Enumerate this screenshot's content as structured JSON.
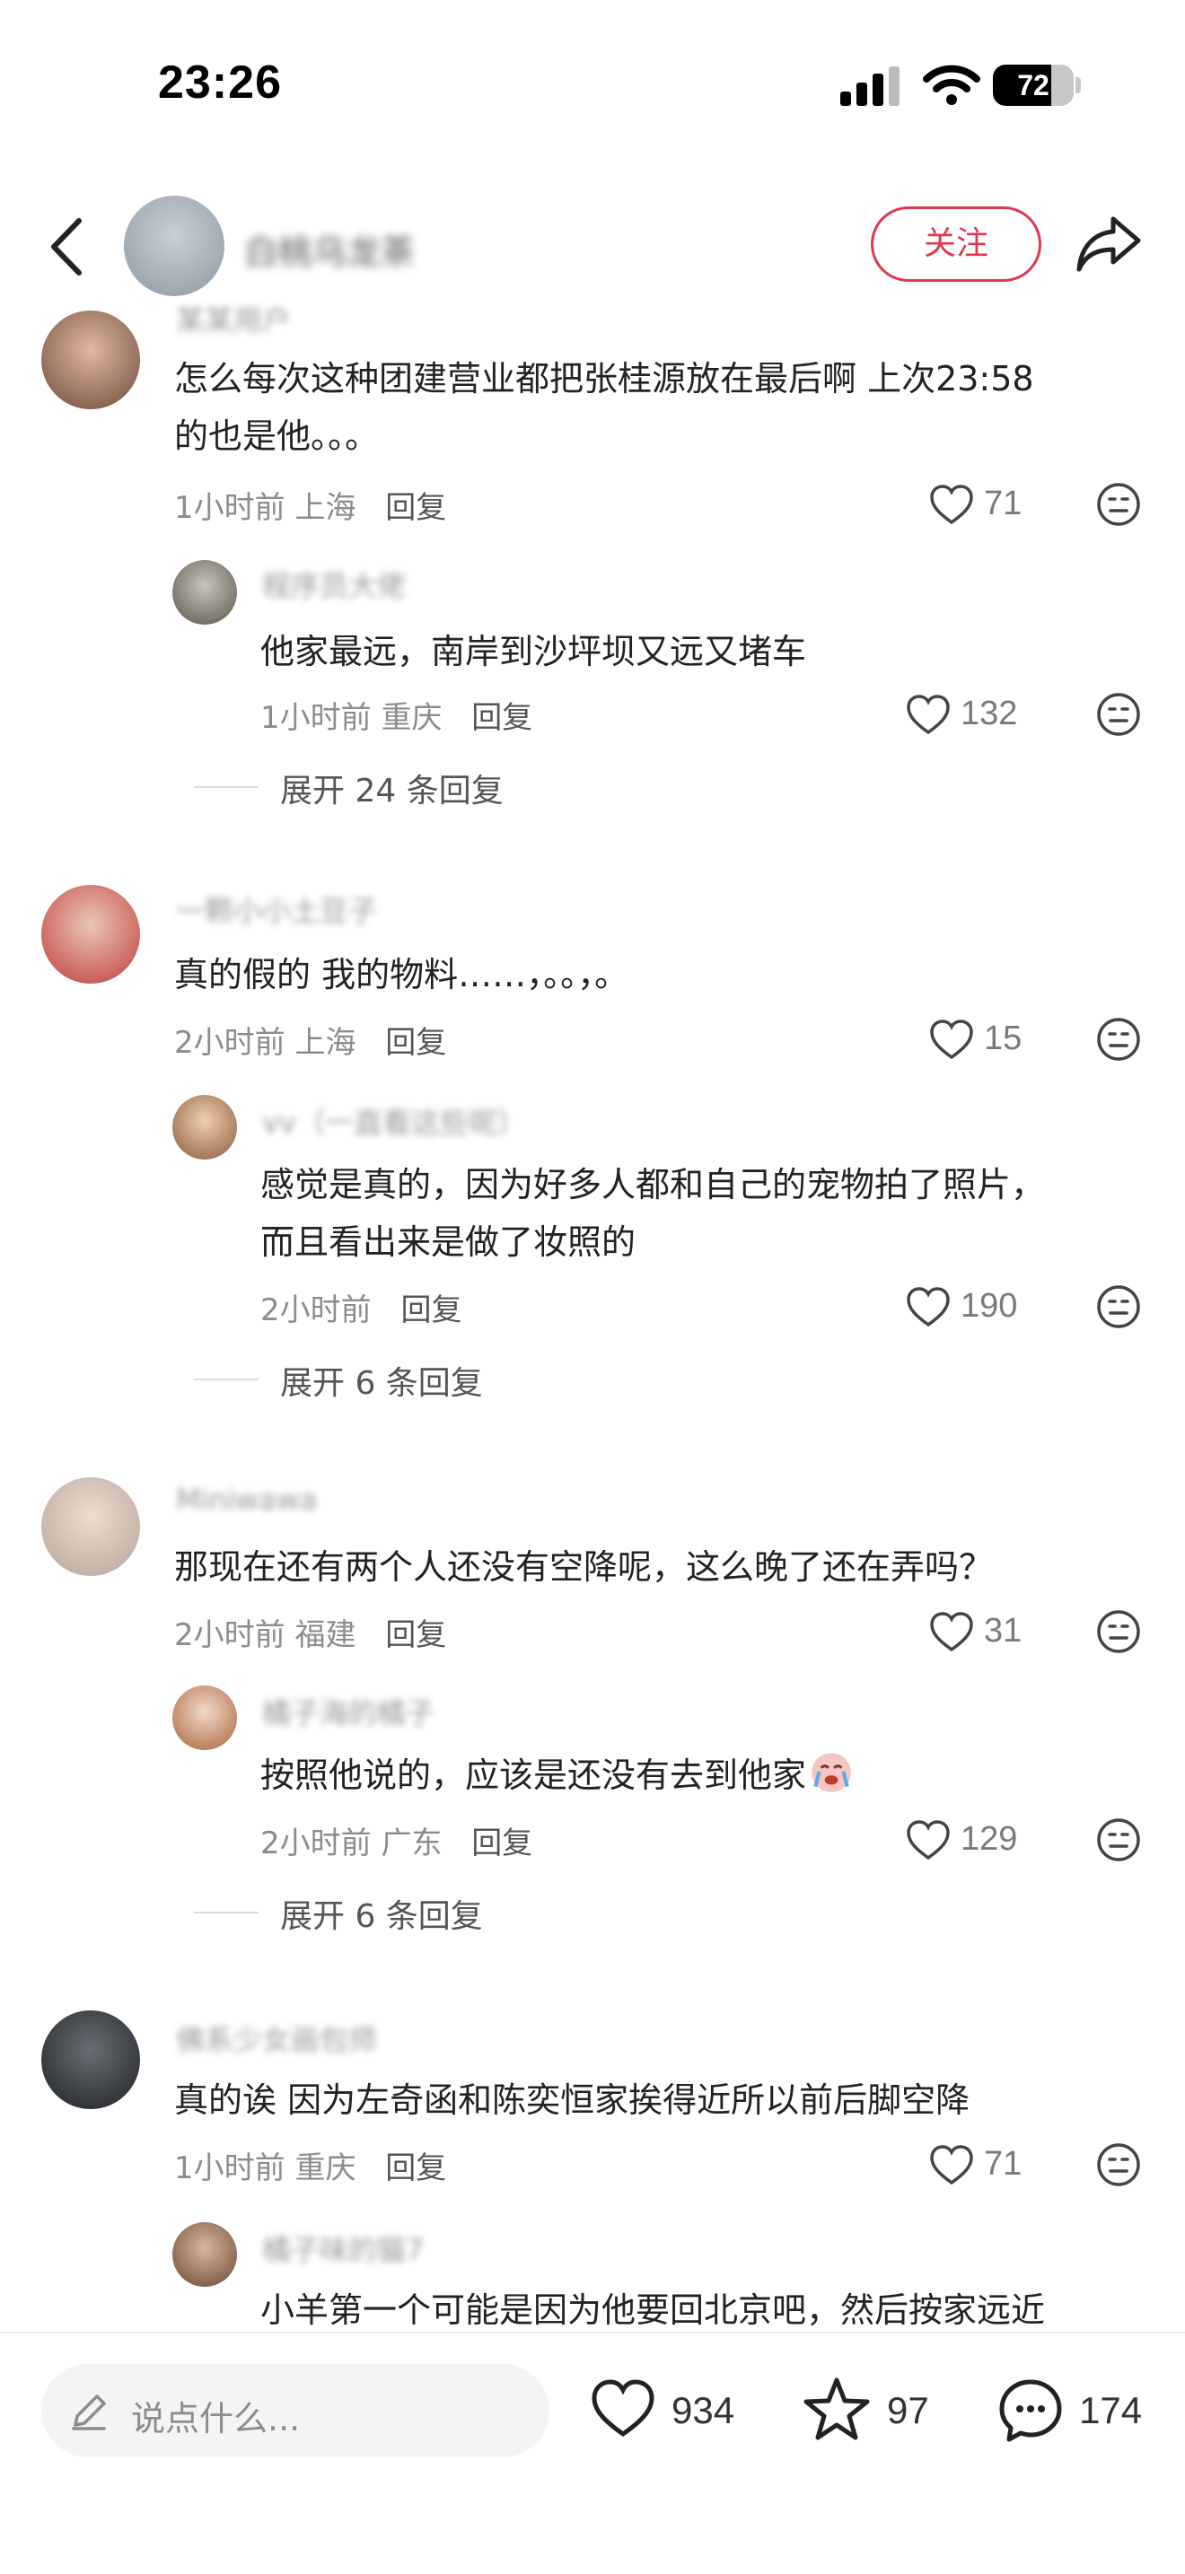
{
  "status_bar": {
    "time": "23:26",
    "battery": "72",
    "battery_level": 0.72
  },
  "header": {
    "author_name": "白桃乌龙茶",
    "follow_label": "关注"
  },
  "comments": [
    {
      "user": "某某用户",
      "text_lines": [
        "怎么每次这种团建营业都把张桂源放在最后啊 上次23:58",
        "的也是他。。。"
      ],
      "time": "1小时前",
      "location": "上海",
      "reply": "回复",
      "likes": "71",
      "sub": {
        "user": "程序员大佬",
        "text_lines": [
          "他家最远，南岸到沙坪坝又远又堵车"
        ],
        "time": "1小时前",
        "location": "重庆",
        "reply": "回复",
        "likes": "132"
      },
      "expand": "展开 24 条回复"
    },
    {
      "user": "一颗小小土豆子",
      "text_lines": [
        "真的假的 我的物料……，。。，。"
      ],
      "time": "2小时前",
      "location": "上海",
      "reply": "回复",
      "likes": "15",
      "sub": {
        "user": "vv（一直看这些呢）",
        "text_lines": [
          "感觉是真的，因为好多人都和自己的宠物拍了照片，",
          "而且看出来是做了妆照的"
        ],
        "time": "2小时前",
        "location": "",
        "reply": "回复",
        "likes": "190"
      },
      "expand": "展开 6 条回复"
    },
    {
      "user": "Miniwawa",
      "text_lines": [
        "那现在还有两个人还没有空降呢，这么晚了还在弄吗？"
      ],
      "time": "2小时前",
      "location": "福建",
      "reply": "回复",
      "likes": "31",
      "sub": {
        "user": "橘子海的橘子",
        "text_lines": [
          "按照他说的，应该是还没有去到他家"
        ],
        "time": "2小时前",
        "location": "广东",
        "reply": "回复",
        "likes": "129"
      },
      "expand": "展开 6 条回复"
    },
    {
      "user": "佛系少女画包师",
      "text_lines": [
        "真的诶 因为左奇函和陈奕恒家挨得近所以前后脚空降"
      ],
      "time": "1小时前",
      "location": "重庆",
      "reply": "回复",
      "likes": "71",
      "sub": {
        "user": "橘子味的猫7",
        "text_lines": [
          "小羊第一个可能是因为他要回北京吧，然后按家远近"
        ],
        "time": "",
        "location": "",
        "reply": "",
        "likes": ""
      },
      "expand": ""
    }
  ],
  "bottom_bar": {
    "input_placeholder": "说点什么...",
    "likes": "934",
    "stars": "97",
    "comments": "174"
  },
  "colors": {
    "accent": "#e0384f",
    "text": "#222222",
    "meta": "#8c8c8c"
  },
  "icons": [
    "back-icon",
    "share-icon",
    "heart-icon",
    "dislike-face-icon",
    "pencil-icon",
    "star-icon",
    "comment-bubble-icon"
  ]
}
